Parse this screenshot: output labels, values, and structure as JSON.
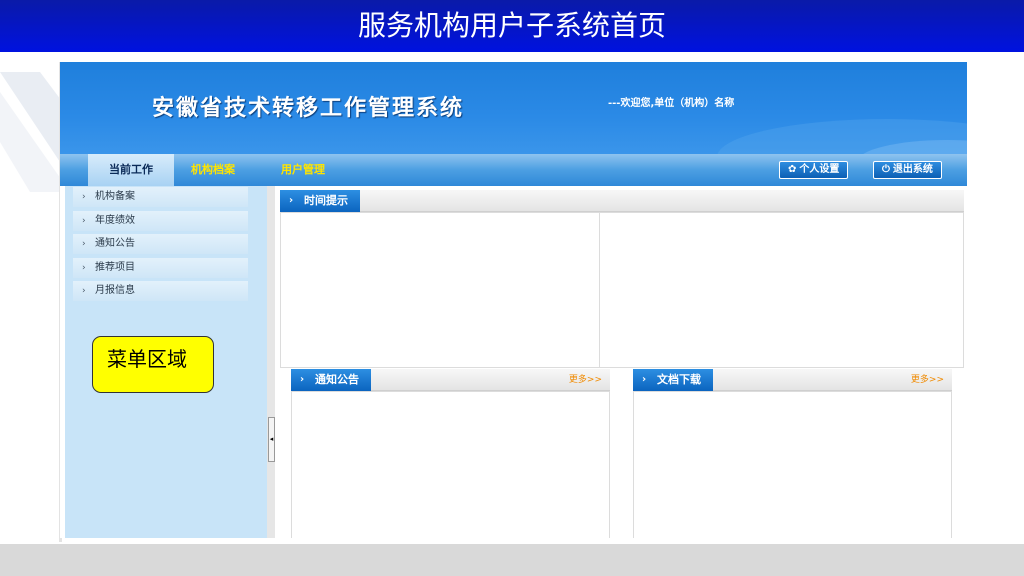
{
  "slide": {
    "title": "服务机构用户子系统首页",
    "colors": {
      "title_bar": "#0012e0",
      "footer": "#d9d9d9"
    }
  },
  "app": {
    "title": "安徽省技术转移工作管理系统",
    "welcome": "---欢迎您,单位（机构）名称",
    "colors": {
      "header": "#2b8ae6",
      "sidebar": "#c8e4f8",
      "accent_yellow": "#ffe400",
      "more_orange": "#f08a00"
    }
  },
  "nav": {
    "items": [
      {
        "label": "当前工作",
        "state": "current"
      },
      {
        "label": "机构档案",
        "state": "highlighted"
      },
      {
        "label": "用户管理",
        "state": "highlighted"
      }
    ],
    "settings_button": {
      "label": "个人设置",
      "icon": "gear-icon"
    },
    "logout_button": {
      "label": "退出系统",
      "icon": "power-icon"
    }
  },
  "sidebar": {
    "items": [
      {
        "label": "机构备案",
        "icon": "chevron-right-icon"
      },
      {
        "label": "年度绩效",
        "icon": "chevron-right-icon"
      },
      {
        "label": "通知公告",
        "icon": "chevron-right-icon"
      },
      {
        "label": "推荐项目",
        "icon": "chevron-right-icon"
      },
      {
        "label": "月报信息",
        "icon": "chevron-right-icon"
      }
    ],
    "note": "菜单区域",
    "collapse_handle": "◂"
  },
  "panels": {
    "time_reminder": {
      "title": "时间提示",
      "arrow": "›"
    },
    "notices": {
      "title": "通知公告",
      "more": "更多>>",
      "arrow": "›"
    },
    "downloads": {
      "title": "文档下载",
      "more": "更多>>",
      "arrow": "›"
    }
  }
}
